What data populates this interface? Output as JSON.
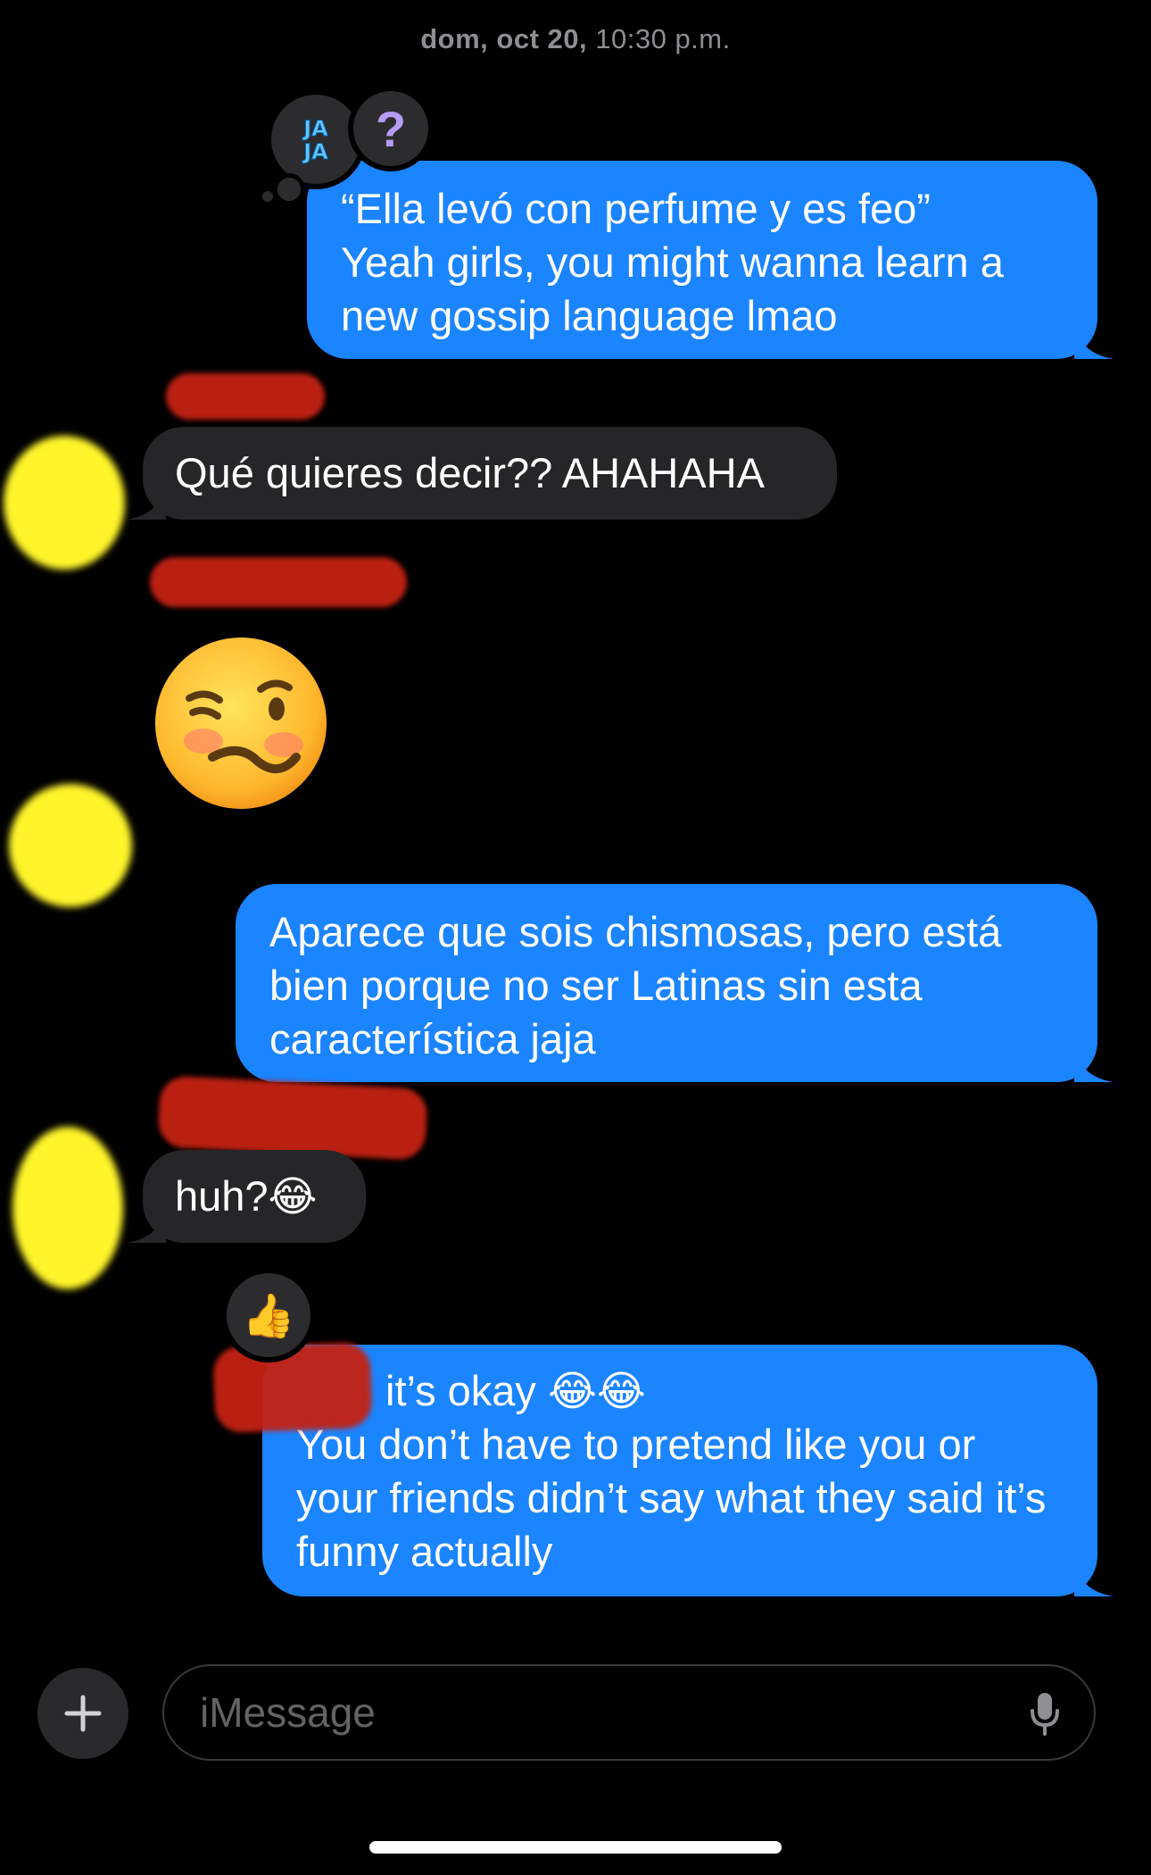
{
  "header": {
    "date": "dom, oct 20,",
    "time": "10:30 p.m."
  },
  "messages": [
    {
      "id": "m1",
      "direction": "outgoing",
      "text": "“Ella levó con perfume y es feo”\nYeah girls, you might wanna learn a new gossip language lmao",
      "reactions": [
        "JA JA",
        "?"
      ]
    },
    {
      "id": "m2",
      "direction": "incoming",
      "text": "Qué quieres decir?? AHAHAHA"
    },
    {
      "id": "m3",
      "direction": "incoming",
      "text": "🥴",
      "type": "emoji"
    },
    {
      "id": "m4",
      "direction": "outgoing",
      "text": "Aparece que sois chismosas, pero está bien porque no ser Latinas sin esta característica jaja"
    },
    {
      "id": "m5",
      "direction": "incoming",
      "text": "huh?😂"
    },
    {
      "id": "m6",
      "direction": "outgoing",
      "text_line1": "it’s okay 😂😂",
      "text_rest": "You don’t have to pretend like you or your friends didn’t say what they said it’s funny actually",
      "reactions": [
        "👍"
      ]
    }
  ],
  "reactions": {
    "jaja": "JA JA",
    "question": "?",
    "thumbs": "👍"
  },
  "composer": {
    "placeholder": "iMessage",
    "plus_icon": "plus-icon",
    "mic_icon": "microphone-icon"
  },
  "colors": {
    "outgoing_bubble": "#1b84ff",
    "incoming_bubble": "#262628",
    "redaction_red": "#c42213",
    "redaction_yellow": "#fff52a"
  }
}
